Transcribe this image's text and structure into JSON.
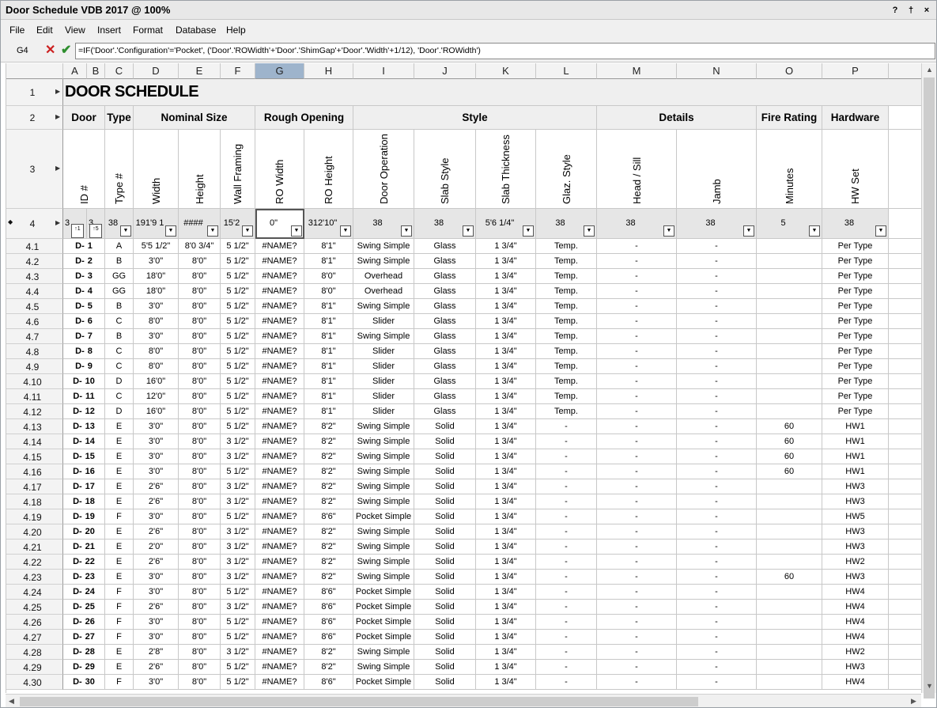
{
  "window": {
    "title": "Door Schedule VDB 2017 @ 100%",
    "help_btn": "?",
    "pin_btn": "†",
    "close_btn": "×"
  },
  "menu": [
    "File",
    "Edit",
    "View",
    "Insert",
    "Format",
    "Database",
    "Help"
  ],
  "formula_bar": {
    "cell_ref": "G4",
    "cancel": "✕",
    "confirm": "✔",
    "formula": "=IF('Door'.'Configuration'='Pocket', ('Door'.'ROWidth'+'Door'.'ShimGap'+'Door'.'Width'+1/12), 'Door'.'ROWidth')"
  },
  "selected_column": "G",
  "columns": [
    "A",
    "B",
    "C",
    "D",
    "E",
    "F",
    "G",
    "H",
    "I",
    "J",
    "K",
    "L",
    "M",
    "N",
    "O",
    "P"
  ],
  "row1": {
    "num": "1",
    "title": "DOOR SCHEDULE"
  },
  "row2": {
    "num": "2",
    "groups": {
      "door": "Door",
      "type": "Type",
      "nominal": "Nominal Size",
      "rough": "Rough Opening",
      "style": "Style",
      "details": "Details",
      "fire": "Fire Rating",
      "hardware": "Hardware"
    }
  },
  "row3": {
    "num": "3",
    "labels": {
      "A": "ID #",
      "C": "Type #",
      "D": "Width",
      "E": "Height",
      "F": "Wall Framing",
      "G": "RO Width",
      "H": "RO Height",
      "I": "Door Operation",
      "J": "Slab Style",
      "K": "Slab Thickness",
      "L": "Glaz. Style",
      "M": "Head / Sill",
      "N": "Jamb",
      "O": "Minutes",
      "P": "HW Set"
    }
  },
  "row4": {
    "num": "4",
    "values": {
      "A": "3",
      "B": "3",
      "C": "38",
      "D": "191'9 1",
      "E": "####",
      "F": "15'2",
      "G": "0\"",
      "H": "312'10\"",
      "I": "38",
      "J": "38",
      "K": "5'6 1/4\"",
      "L": "38",
      "M": "38",
      "N": "38",
      "O": "5",
      "P": "38"
    },
    "sort_a": "↑1",
    "sort_b": "↑5"
  },
  "rows": [
    [
      "4.1",
      "D-",
      "1",
      "A",
      "5'5 1/2\"",
      "8'0 3/4\"",
      "5 1/2\"",
      "#NAME?",
      "8'1\"",
      "Swing Simple",
      "Glass",
      "1 3/4\"",
      "Temp.",
      "-",
      "-",
      "",
      "Per Type"
    ],
    [
      "4.2",
      "D-",
      "2",
      "B",
      "3'0\"",
      "8'0\"",
      "5 1/2\"",
      "#NAME?",
      "8'1\"",
      "Swing Simple",
      "Glass",
      "1 3/4\"",
      "Temp.",
      "-",
      "-",
      "",
      "Per Type"
    ],
    [
      "4.3",
      "D-",
      "3",
      "GG",
      "18'0\"",
      "8'0\"",
      "5 1/2\"",
      "#NAME?",
      "8'0\"",
      "Overhead",
      "Glass",
      "1 3/4\"",
      "Temp.",
      "-",
      "-",
      "",
      "Per Type"
    ],
    [
      "4.4",
      "D-",
      "4",
      "GG",
      "18'0\"",
      "8'0\"",
      "5 1/2\"",
      "#NAME?",
      "8'0\"",
      "Overhead",
      "Glass",
      "1 3/4\"",
      "Temp.",
      "-",
      "-",
      "",
      "Per Type"
    ],
    [
      "4.5",
      "D-",
      "5",
      "B",
      "3'0\"",
      "8'0\"",
      "5 1/2\"",
      "#NAME?",
      "8'1\"",
      "Swing Simple",
      "Glass",
      "1 3/4\"",
      "Temp.",
      "-",
      "-",
      "",
      "Per Type"
    ],
    [
      "4.6",
      "D-",
      "6",
      "C",
      "8'0\"",
      "8'0\"",
      "5 1/2\"",
      "#NAME?",
      "8'1\"",
      "Slider",
      "Glass",
      "1 3/4\"",
      "Temp.",
      "-",
      "-",
      "",
      "Per Type"
    ],
    [
      "4.7",
      "D-",
      "7",
      "B",
      "3'0\"",
      "8'0\"",
      "5 1/2\"",
      "#NAME?",
      "8'1\"",
      "Swing Simple",
      "Glass",
      "1 3/4\"",
      "Temp.",
      "-",
      "-",
      "",
      "Per Type"
    ],
    [
      "4.8",
      "D-",
      "8",
      "C",
      "8'0\"",
      "8'0\"",
      "5 1/2\"",
      "#NAME?",
      "8'1\"",
      "Slider",
      "Glass",
      "1 3/4\"",
      "Temp.",
      "-",
      "-",
      "",
      "Per Type"
    ],
    [
      "4.9",
      "D-",
      "9",
      "C",
      "8'0\"",
      "8'0\"",
      "5 1/2\"",
      "#NAME?",
      "8'1\"",
      "Slider",
      "Glass",
      "1 3/4\"",
      "Temp.",
      "-",
      "-",
      "",
      "Per Type"
    ],
    [
      "4.10",
      "D-",
      "10",
      "D",
      "16'0\"",
      "8'0\"",
      "5 1/2\"",
      "#NAME?",
      "8'1\"",
      "Slider",
      "Glass",
      "1 3/4\"",
      "Temp.",
      "-",
      "-",
      "",
      "Per Type"
    ],
    [
      "4.11",
      "D-",
      "11",
      "C",
      "12'0\"",
      "8'0\"",
      "5 1/2\"",
      "#NAME?",
      "8'1\"",
      "Slider",
      "Glass",
      "1 3/4\"",
      "Temp.",
      "-",
      "-",
      "",
      "Per Type"
    ],
    [
      "4.12",
      "D-",
      "12",
      "D",
      "16'0\"",
      "8'0\"",
      "5 1/2\"",
      "#NAME?",
      "8'1\"",
      "Slider",
      "Glass",
      "1 3/4\"",
      "Temp.",
      "-",
      "-",
      "",
      "Per Type"
    ],
    [
      "4.13",
      "D-",
      "13",
      "E",
      "3'0\"",
      "8'0\"",
      "5 1/2\"",
      "#NAME?",
      "8'2\"",
      "Swing Simple",
      "Solid",
      "1 3/4\"",
      "-",
      "-",
      "-",
      "60",
      "HW1"
    ],
    [
      "4.14",
      "D-",
      "14",
      "E",
      "3'0\"",
      "8'0\"",
      "3 1/2\"",
      "#NAME?",
      "8'2\"",
      "Swing Simple",
      "Solid",
      "1 3/4\"",
      "-",
      "-",
      "-",
      "60",
      "HW1"
    ],
    [
      "4.15",
      "D-",
      "15",
      "E",
      "3'0\"",
      "8'0\"",
      "3 1/2\"",
      "#NAME?",
      "8'2\"",
      "Swing Simple",
      "Solid",
      "1 3/4\"",
      "-",
      "-",
      "-",
      "60",
      "HW1"
    ],
    [
      "4.16",
      "D-",
      "16",
      "E",
      "3'0\"",
      "8'0\"",
      "5 1/2\"",
      "#NAME?",
      "8'2\"",
      "Swing Simple",
      "Solid",
      "1 3/4\"",
      "-",
      "-",
      "-",
      "60",
      "HW1"
    ],
    [
      "4.17",
      "D-",
      "17",
      "E",
      "2'6\"",
      "8'0\"",
      "3 1/2\"",
      "#NAME?",
      "8'2\"",
      "Swing Simple",
      "Solid",
      "1 3/4\"",
      "-",
      "-",
      "-",
      "",
      "HW3"
    ],
    [
      "4.18",
      "D-",
      "18",
      "E",
      "2'6\"",
      "8'0\"",
      "3 1/2\"",
      "#NAME?",
      "8'2\"",
      "Swing Simple",
      "Solid",
      "1 3/4\"",
      "-",
      "-",
      "-",
      "",
      "HW3"
    ],
    [
      "4.19",
      "D-",
      "19",
      "F",
      "3'0\"",
      "8'0\"",
      "5 1/2\"",
      "#NAME?",
      "8'6\"",
      "Pocket Simple",
      "Solid",
      "1 3/4\"",
      "-",
      "-",
      "-",
      "",
      "HW5"
    ],
    [
      "4.20",
      "D-",
      "20",
      "E",
      "2'6\"",
      "8'0\"",
      "3 1/2\"",
      "#NAME?",
      "8'2\"",
      "Swing Simple",
      "Solid",
      "1 3/4\"",
      "-",
      "-",
      "-",
      "",
      "HW3"
    ],
    [
      "4.21",
      "D-",
      "21",
      "E",
      "2'0\"",
      "8'0\"",
      "3 1/2\"",
      "#NAME?",
      "8'2\"",
      "Swing Simple",
      "Solid",
      "1 3/4\"",
      "-",
      "-",
      "-",
      "",
      "HW3"
    ],
    [
      "4.22",
      "D-",
      "22",
      "E",
      "2'6\"",
      "8'0\"",
      "3 1/2\"",
      "#NAME?",
      "8'2\"",
      "Swing Simple",
      "Solid",
      "1 3/4\"",
      "-",
      "-",
      "-",
      "",
      "HW2"
    ],
    [
      "4.23",
      "D-",
      "23",
      "E",
      "3'0\"",
      "8'0\"",
      "3 1/2\"",
      "#NAME?",
      "8'2\"",
      "Swing Simple",
      "Solid",
      "1 3/4\"",
      "-",
      "-",
      "-",
      "60",
      "HW3"
    ],
    [
      "4.24",
      "D-",
      "24",
      "F",
      "3'0\"",
      "8'0\"",
      "5 1/2\"",
      "#NAME?",
      "8'6\"",
      "Pocket Simple",
      "Solid",
      "1 3/4\"",
      "-",
      "-",
      "-",
      "",
      "HW4"
    ],
    [
      "4.25",
      "D-",
      "25",
      "F",
      "2'6\"",
      "8'0\"",
      "3 1/2\"",
      "#NAME?",
      "8'6\"",
      "Pocket Simple",
      "Solid",
      "1 3/4\"",
      "-",
      "-",
      "-",
      "",
      "HW4"
    ],
    [
      "4.26",
      "D-",
      "26",
      "F",
      "3'0\"",
      "8'0\"",
      "5 1/2\"",
      "#NAME?",
      "8'6\"",
      "Pocket Simple",
      "Solid",
      "1 3/4\"",
      "-",
      "-",
      "-",
      "",
      "HW4"
    ],
    [
      "4.27",
      "D-",
      "27",
      "F",
      "3'0\"",
      "8'0\"",
      "5 1/2\"",
      "#NAME?",
      "8'6\"",
      "Pocket Simple",
      "Solid",
      "1 3/4\"",
      "-",
      "-",
      "-",
      "",
      "HW4"
    ],
    [
      "4.28",
      "D-",
      "28",
      "E",
      "2'8\"",
      "8'0\"",
      "3 1/2\"",
      "#NAME?",
      "8'2\"",
      "Swing Simple",
      "Solid",
      "1 3/4\"",
      "-",
      "-",
      "-",
      "",
      "HW2"
    ],
    [
      "4.29",
      "D-",
      "29",
      "E",
      "2'6\"",
      "8'0\"",
      "5 1/2\"",
      "#NAME?",
      "8'2\"",
      "Swing Simple",
      "Solid",
      "1 3/4\"",
      "-",
      "-",
      "-",
      "",
      "HW3"
    ],
    [
      "4.30",
      "D-",
      "30",
      "F",
      "3'0\"",
      "8'0\"",
      "5 1/2\"",
      "#NAME?",
      "8'6\"",
      "Pocket Simple",
      "Solid",
      "1 3/4\"",
      "-",
      "-",
      "-",
      "",
      "HW4"
    ]
  ],
  "colors": {
    "selected_header": "#9eb4cc",
    "header_band": "#efefef",
    "grid_line": "#c8c8c8"
  },
  "icons": {
    "dropdown": "chevron-down-icon",
    "row_arrow": "row-expand-icon",
    "scroll_up": "scroll-up-icon",
    "scroll_down": "scroll-down-icon",
    "scroll_left": "scroll-left-icon",
    "scroll_right": "scroll-right-icon"
  }
}
